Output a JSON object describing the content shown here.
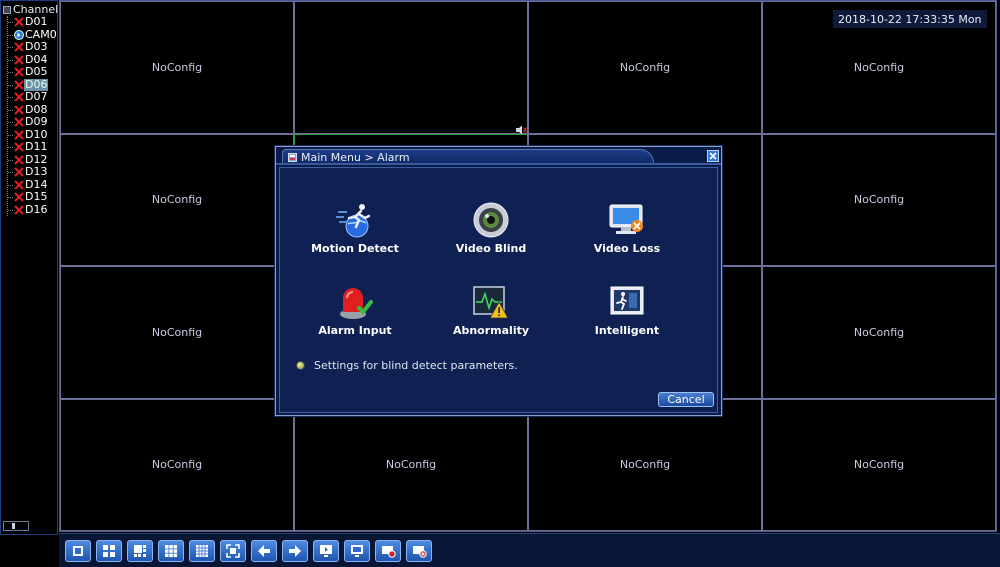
{
  "sidebar": {
    "header": "Channel",
    "channels": [
      {
        "label": "D01",
        "status": "disconnected"
      },
      {
        "label": "CAM0",
        "status": "connected"
      },
      {
        "label": "D03",
        "status": "disconnected"
      },
      {
        "label": "D04",
        "status": "disconnected"
      },
      {
        "label": "D05",
        "status": "disconnected"
      },
      {
        "label": "D06",
        "status": "disconnected",
        "selected": true
      },
      {
        "label": "D07",
        "status": "disconnected"
      },
      {
        "label": "D08",
        "status": "disconnected"
      },
      {
        "label": "D09",
        "status": "disconnected"
      },
      {
        "label": "D10",
        "status": "disconnected"
      },
      {
        "label": "D11",
        "status": "disconnected"
      },
      {
        "label": "D12",
        "status": "disconnected"
      },
      {
        "label": "D13",
        "status": "disconnected"
      },
      {
        "label": "D14",
        "status": "disconnected"
      },
      {
        "label": "D15",
        "status": "disconnected"
      },
      {
        "label": "D16",
        "status": "disconnected"
      }
    ]
  },
  "grid": {
    "cells": [
      "NoConfig",
      "",
      "NoConfig",
      "NoConfig",
      "NoConfig",
      "",
      "",
      "NoConfig",
      "NoConfig",
      "",
      "",
      "NoConfig",
      "NoConfig",
      "NoConfig",
      "NoConfig",
      "NoConfig"
    ],
    "datetime": "2018-10-22 17:33:35 Mon"
  },
  "dialog": {
    "title": "Main Menu > Alarm",
    "options": [
      {
        "label": "Motion Detect",
        "icon": "motion-detect-icon"
      },
      {
        "label": "Video Blind",
        "icon": "video-blind-icon"
      },
      {
        "label": "Video Loss",
        "icon": "video-loss-icon"
      },
      {
        "label": "Alarm Input",
        "icon": "alarm-input-icon"
      },
      {
        "label": "Abnormality",
        "icon": "abnormality-icon"
      },
      {
        "label": "Intelligent",
        "icon": "intelligent-icon"
      }
    ],
    "hint": "Settings for blind detect parameters.",
    "cancel_label": "Cancel"
  },
  "toolbar": {
    "buttons": [
      "single-view-icon",
      "quad-view-icon",
      "eight-view-icon",
      "nine-view-icon",
      "sixteen-view-icon",
      "fullscreen-icon",
      "previous-icon",
      "next-icon",
      "playback-icon",
      "tour-icon",
      "record-icon",
      "stop-record-icon"
    ]
  },
  "colors": {
    "accent": "#2f7ad8",
    "dialog_bg": "#0f2052",
    "grid_line": "#6c6e9c",
    "disconnected": "#e02020"
  }
}
